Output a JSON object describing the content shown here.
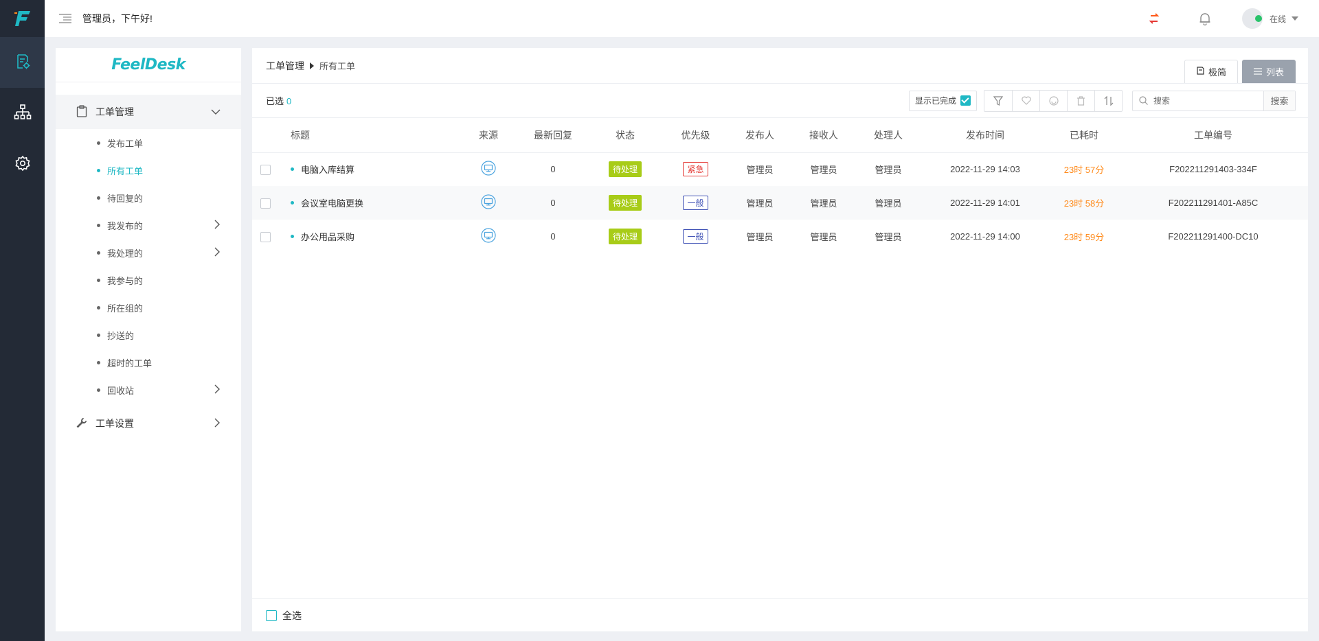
{
  "app": {
    "logo_icon": "feeldesk-f-logo",
    "brand": "FeelDesk",
    "accent_color": "#1fb8c4"
  },
  "rail": {
    "items": [
      {
        "icon": "ticket-doc-gear-icon",
        "active": true
      },
      {
        "icon": "org-chart-icon",
        "active": false
      },
      {
        "icon": "gear-icon",
        "active": false
      }
    ]
  },
  "topbar": {
    "greeting": "管理员，下午好!",
    "user_status": "在线"
  },
  "sidebar": {
    "group1": {
      "label": "工单管理",
      "icon": "clipboard-icon"
    },
    "items": [
      {
        "label": "发布工单",
        "has_children": false
      },
      {
        "label": "所有工单",
        "has_children": false,
        "active": true
      },
      {
        "label": "待回复的",
        "has_children": false
      },
      {
        "label": "我发布的",
        "has_children": true
      },
      {
        "label": "我处理的",
        "has_children": true
      },
      {
        "label": "我参与的",
        "has_children": false
      },
      {
        "label": "所在组的",
        "has_children": false
      },
      {
        "label": "抄送的",
        "has_children": false
      },
      {
        "label": "超时的工单",
        "has_children": false
      },
      {
        "label": "回收站",
        "has_children": true
      }
    ],
    "group2": {
      "label": "工单设置",
      "icon": "wrench-icon"
    }
  },
  "main": {
    "breadcrumb": [
      "工单管理",
      "所有工单"
    ],
    "views": {
      "simple": "极简",
      "list": "列表"
    },
    "selected_label": "已选",
    "selected_count": "0",
    "show_done_label": "显示已完成",
    "search": {
      "placeholder": "搜索",
      "button": "搜索"
    },
    "columns": [
      "标题",
      "来源",
      "最新回复",
      "状态",
      "优先级",
      "发布人",
      "接收人",
      "处理人",
      "发布时间",
      "已耗时",
      "工单编号"
    ],
    "rows": [
      {
        "title": "电脑入库结算",
        "source_icon": "monitor-icon",
        "replies": "0",
        "status": "待处理",
        "priority": "紧急",
        "priority_level": "urgent",
        "publisher": "管理员",
        "receiver": "管理员",
        "handler": "管理员",
        "time": "2022-11-29 14:03",
        "elapsed": "23时 57分",
        "number": "F202211291403-334F"
      },
      {
        "title": "会议室电脑更换",
        "source_icon": "monitor-icon",
        "replies": "0",
        "status": "待处理",
        "priority": "一般",
        "priority_level": "normal",
        "publisher": "管理员",
        "receiver": "管理员",
        "handler": "管理员",
        "time": "2022-11-29 14:01",
        "elapsed": "23时 58分",
        "number": "F202211291401-A85C"
      },
      {
        "title": "办公用品采购",
        "source_icon": "monitor-icon",
        "replies": "0",
        "status": "待处理",
        "priority": "一般",
        "priority_level": "normal",
        "publisher": "管理员",
        "receiver": "管理员",
        "handler": "管理员",
        "time": "2022-11-29 14:00",
        "elapsed": "23时 59分",
        "number": "F202211291400-DC10"
      }
    ],
    "select_all_label": "全选"
  }
}
